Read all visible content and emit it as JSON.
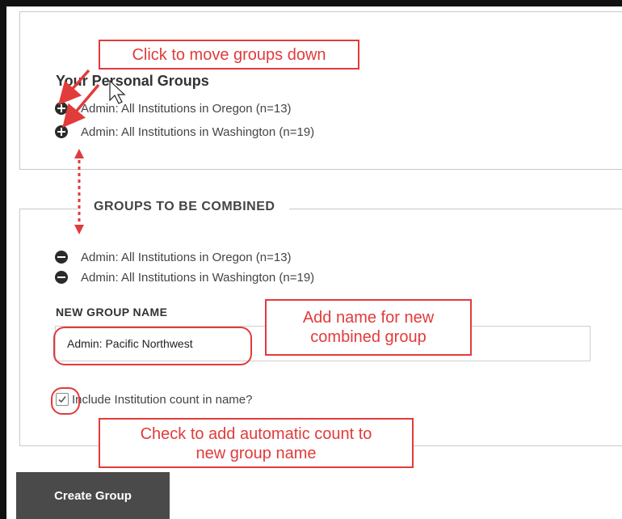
{
  "personal_groups": {
    "title": "Your Personal Groups",
    "items": [
      {
        "label": "Admin: All Institutions in Oregon (n=13)",
        "icon": "plus-circle-icon"
      },
      {
        "label": "Admin: All Institutions in Washington (n=19)",
        "icon": "plus-circle-icon"
      }
    ]
  },
  "combined_groups": {
    "title": "GROUPS TO BE COMBINED",
    "items": [
      {
        "label": "Admin: All Institutions in Oregon (n=13)",
        "icon": "minus-circle-icon"
      },
      {
        "label": "Admin: All Institutions in Washington (n=19)",
        "icon": "minus-circle-icon"
      }
    ]
  },
  "new_group": {
    "label": "NEW GROUP NAME",
    "value": "Admin: Pacific Northwest",
    "include_count_label": "Include Institution count in name?",
    "include_count_checked": true
  },
  "create_button": {
    "label": "Create Group"
  },
  "annotations": {
    "move_down": "Click to move groups down",
    "add_name": [
      "Add name for new",
      "combined group"
    ],
    "add_count": [
      "Check to add automatic count to",
      "new group name"
    ],
    "color": "#e23b3b"
  }
}
